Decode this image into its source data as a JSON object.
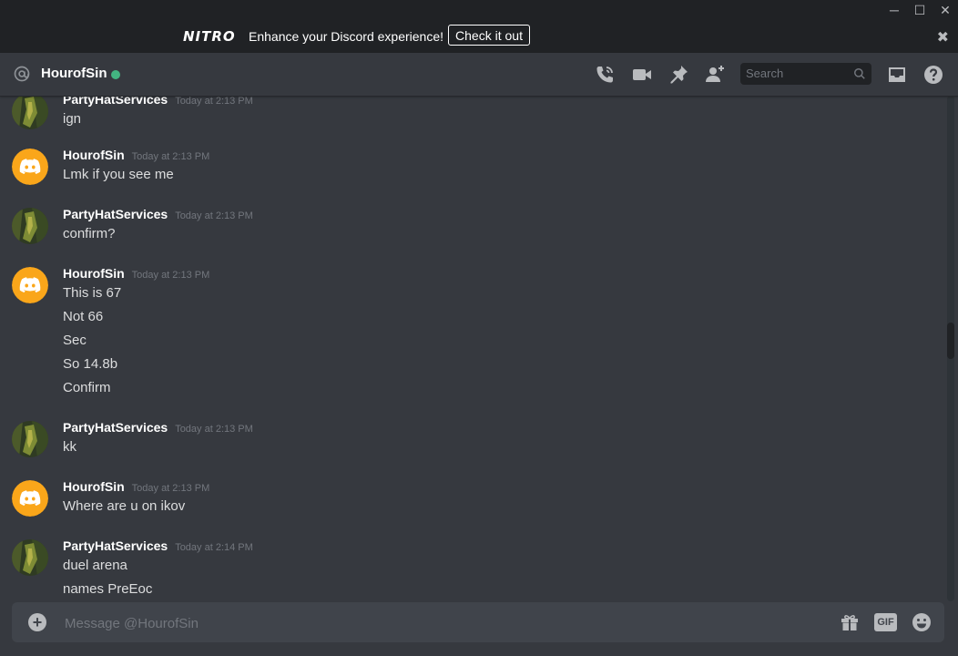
{
  "window": {
    "controls": [
      "─",
      "☐",
      "✕"
    ]
  },
  "nitro": {
    "logo": "NITRO",
    "text": "Enhance your Discord experience!",
    "button": "Check it out",
    "close": "✖"
  },
  "header": {
    "name": "HourofSin",
    "status_color": "#43b581",
    "icons": [
      "call-icon",
      "video-icon",
      "pin-icon",
      "add-member-icon",
      "inbox-icon",
      "help-icon"
    ],
    "search_placeholder": "Search"
  },
  "messages": [
    {
      "author": "PartyHatServices",
      "time": "Today at 2:13 PM",
      "avatar": "photo",
      "lines": [
        "ign"
      ]
    },
    {
      "author": "HourofSin",
      "time": "Today at 2:13 PM",
      "avatar": "discord",
      "lines": [
        "Lmk if you see me"
      ]
    },
    {
      "author": "PartyHatServices",
      "time": "Today at 2:13 PM",
      "avatar": "photo",
      "lines": [
        "confirm?"
      ]
    },
    {
      "author": "HourofSin",
      "time": "Today at 2:13 PM",
      "avatar": "discord",
      "lines": [
        "This is 67",
        "Not 66",
        "Sec",
        "So 14.8b",
        "Confirm"
      ]
    },
    {
      "author": "PartyHatServices",
      "time": "Today at 2:13 PM",
      "avatar": "photo",
      "lines": [
        "kk"
      ]
    },
    {
      "author": "HourofSin",
      "time": "Today at 2:13 PM",
      "avatar": "discord",
      "lines": [
        "Where are u on ikov"
      ]
    },
    {
      "author": "PartyHatServices",
      "time": "Today at 2:14 PM",
      "avatar": "photo",
      "lines": [
        "duel arena",
        "names PreEoc"
      ]
    }
  ],
  "composer": {
    "add": "+",
    "placeholder": "Message @HourofSin",
    "gif": "GIF"
  },
  "colors": {
    "discord_avatar": "#faa61a",
    "background": "#36393f",
    "topbar": "#202225"
  }
}
